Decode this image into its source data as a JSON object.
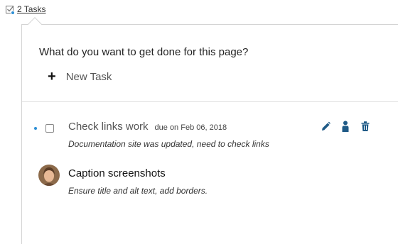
{
  "toggle": {
    "label": "2 Tasks"
  },
  "panel": {
    "prompt": "What do you want to get done for this page?",
    "new_task": {
      "plus": "+",
      "label": "New Task"
    }
  },
  "tasks": [
    {
      "title": "Check links work",
      "due": "due on Feb 06, 2018",
      "description": "Documentation site was updated, need to check links",
      "unread": true,
      "actions": [
        "pencil-icon",
        "person-icon",
        "trash-icon"
      ]
    },
    {
      "title": "Caption screenshots",
      "description": "Ensure title and alt text, add borders.",
      "assignee": "avatar"
    }
  ],
  "colors": {
    "accent": "#2d8fd5",
    "border": "#d4d4d4",
    "icon": "#1f5a86"
  }
}
